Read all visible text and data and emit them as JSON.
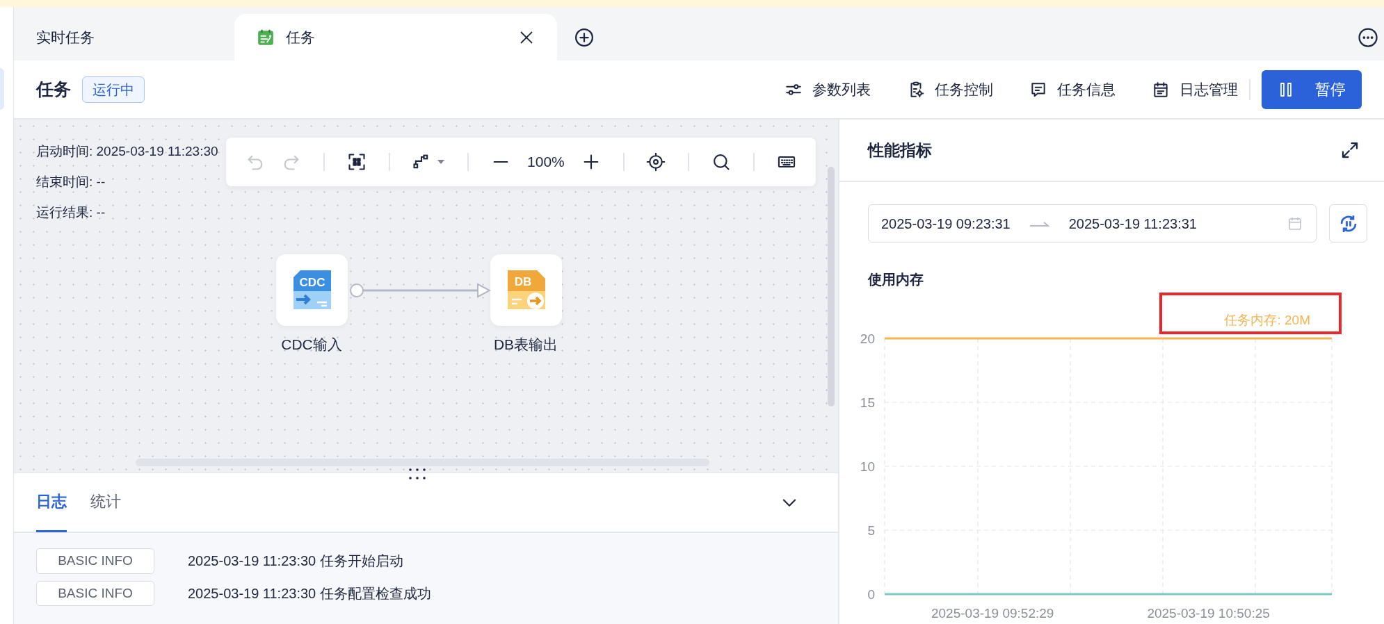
{
  "tabs": [
    {
      "label": "实时任务",
      "selected": false,
      "kind": "plain"
    },
    {
      "label": "任务",
      "selected": true,
      "kind": "task",
      "closable": true
    }
  ],
  "header": {
    "title": "任务",
    "status": "运行中",
    "actions": [
      {
        "label": "参数列表"
      },
      {
        "label": "任务控制"
      },
      {
        "label": "任务信息"
      },
      {
        "label": "日志管理"
      }
    ],
    "primary_button": {
      "label": "暂停"
    }
  },
  "run_info": [
    "启动时间: 2025-03-19 11:23:30",
    "结束时间: --",
    "运行结果: --"
  ],
  "canvas_toolbar": {
    "undo_disabled": true,
    "redo_disabled": true,
    "zoom": "100%"
  },
  "nodes": [
    {
      "label": "CDC输入",
      "kind": "source",
      "badge": "CDC"
    },
    {
      "label": "DB表输出",
      "kind": "target",
      "badge": "DB"
    }
  ],
  "bottom_tabs": [
    {
      "label": "日志",
      "selected": true
    },
    {
      "label": "统计",
      "selected": false
    }
  ],
  "logs": [
    {
      "level": "BASIC INFO",
      "message": "2025-03-19 11:23:30 任务开始启动"
    },
    {
      "level": "BASIC INFO",
      "message": "2025-03-19 11:23:30 任务配置检查成功"
    }
  ],
  "metrics": {
    "title": "性能指标",
    "range_start": "2025-03-19 09:23:31",
    "range_end": "2025-03-19 11:23:31",
    "limit_label": "任务内存: 20M",
    "limit_highlighted": true,
    "chart_data": {
      "type": "line",
      "title": "使用内存",
      "categories": [
        null,
        null,
        null,
        null,
        null,
        null,
        null,
        "2025-03-19 09:52:29",
        null,
        null,
        null,
        null,
        null,
        null,
        null,
        null,
        null,
        null,
        null,
        null,
        null,
        "2025-03-19 10:50:25",
        null,
        null,
        null,
        null,
        null,
        null,
        null,
        null
      ],
      "series": [
        {
          "color": "#f4b453",
          "values": [
            20,
            20,
            20,
            20,
            20,
            20,
            20,
            20,
            20,
            20,
            20,
            20,
            20,
            20,
            20,
            20,
            20,
            20,
            20,
            20,
            20,
            20,
            20,
            20,
            20,
            20,
            20,
            20,
            20,
            20
          ]
        },
        {
          "color": "#7ccbc2",
          "values": [
            0,
            0,
            0,
            0,
            0,
            0,
            0,
            0,
            0,
            0,
            0,
            0,
            0,
            0,
            0,
            0,
            0,
            0,
            0,
            0,
            0,
            0,
            0,
            0,
            0,
            0,
            0,
            0,
            0,
            0
          ]
        }
      ],
      "ylim": [
        0,
        20
      ],
      "yticks": [
        0,
        5,
        10,
        15,
        20
      ],
      "grid": true
    }
  }
}
